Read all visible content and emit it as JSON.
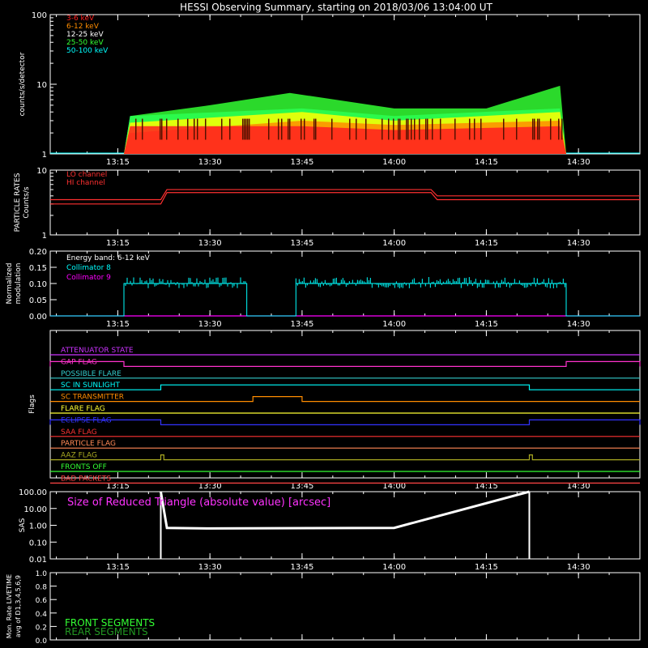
{
  "title": "HESSI Observing Summary, starting on 2018/03/06 13:04:00 UT",
  "time_labels": [
    "13:15",
    "13:30",
    "13:45",
    "14:00",
    "14:15",
    "14:30"
  ],
  "colors": {
    "bg": "#000000",
    "axis": "#ffffff",
    "band_3_6": "#ff2020",
    "band_6_12": "#ff8c00",
    "band_12_25": "#ffff00",
    "band_25_50": "#33ff33",
    "band_50_100": "#00ffff",
    "lo": "#ff3030",
    "hi": "#ff3030",
    "coll8": "#00ffff",
    "coll9": "#ff00ff",
    "sas": "#ffffff",
    "front": "#33ff33",
    "rear": "#229922"
  },
  "chart_data": [
    {
      "type": "line",
      "panel": "count-rates",
      "ylabel": "counts/s/detector",
      "ylim": [
        1,
        100
      ],
      "yscale": "log",
      "yticks": [
        "1",
        "10",
        "100"
      ],
      "legend": [
        "3-6 keV",
        "6-12 keV",
        "12-25 keV",
        "25-50 keV",
        "50-100 keV"
      ],
      "series": [
        {
          "name": "3-6 keV",
          "x": [
            "13:04",
            "13:16",
            "13:17",
            "13:45",
            "14:00",
            "14:27",
            "14:28",
            "14:40"
          ],
          "values": [
            1,
            1,
            2.5,
            2.5,
            2.2,
            2.5,
            1,
            1
          ]
        },
        {
          "name": "6-12 keV",
          "x": [
            "13:04",
            "13:16",
            "13:17",
            "13:45",
            "14:00",
            "14:27",
            "14:28",
            "14:40"
          ],
          "values": [
            1,
            1,
            2.0,
            3.0,
            2.6,
            3.0,
            1,
            1
          ]
        },
        {
          "name": "12-25 keV",
          "x": [
            "13:04",
            "13:16",
            "13:17",
            "13:45",
            "14:00",
            "14:27",
            "14:28",
            "14:40"
          ],
          "values": [
            1,
            1,
            2.8,
            4.0,
            3.0,
            4.0,
            1,
            1
          ]
        },
        {
          "name": "25-50 keV",
          "x": [
            "13:04",
            "13:16",
            "13:17",
            "13:30",
            "13:43",
            "14:00",
            "14:15",
            "14:27",
            "14:28",
            "14:40"
          ],
          "values": [
            1,
            1,
            3.5,
            5.0,
            7.5,
            4.5,
            4.5,
            9.5,
            1,
            1
          ]
        },
        {
          "name": "50-100 keV",
          "x": [
            "13:04",
            "13:16",
            "13:17",
            "13:45",
            "14:00",
            "14:27",
            "14:28",
            "14:40"
          ],
          "values": [
            1,
            1,
            3.5,
            4.5,
            3.5,
            4.5,
            1,
            1
          ]
        }
      ]
    },
    {
      "type": "line",
      "panel": "particle-rates",
      "ylabel": "PARTICLE RATES Counts/s",
      "ylim": [
        1,
        10
      ],
      "yscale": "log",
      "yticks": [
        "1",
        "10"
      ],
      "legend": [
        "LO channel",
        "HI channel"
      ],
      "series": [
        {
          "name": "LO channel",
          "x": [
            "13:04",
            "13:22",
            "13:23",
            "14:06",
            "14:07",
            "14:40"
          ],
          "values": [
            3.5,
            3.5,
            5.0,
            5.0,
            4.0,
            4.0
          ]
        },
        {
          "name": "HI channel",
          "x": [
            "13:04",
            "13:22",
            "13:23",
            "14:06",
            "14:07",
            "14:40"
          ],
          "values": [
            3.0,
            3.0,
            4.5,
            4.5,
            3.5,
            3.5
          ]
        }
      ]
    },
    {
      "type": "line",
      "panel": "modulation",
      "ylabel": "Normalized modulation",
      "ylim": [
        0,
        0.2
      ],
      "yticks": [
        "0.00",
        "0.05",
        "0.10",
        "0.15",
        "0.20"
      ],
      "legend": [
        "Energy band: 6-12 keV",
        "Collimator 8",
        "Collimator 9"
      ],
      "series": [
        {
          "name": "Collimator 8",
          "x": [
            "13:04",
            "13:16",
            "13:16",
            "13:36",
            "13:36",
            "13:44",
            "13:44",
            "14:28",
            "14:28",
            "14:40"
          ],
          "values": [
            0,
            0,
            0.1,
            0.1,
            0,
            0,
            0.1,
            0.1,
            0,
            0
          ]
        },
        {
          "name": "Collimator 9",
          "x": [
            "13:04",
            "14:40"
          ],
          "values": [
            0,
            0
          ]
        }
      ]
    },
    {
      "type": "line",
      "panel": "flags",
      "ylabel": "Flags",
      "flags": [
        {
          "name": "ATTENUATOR STATE",
          "color": "#cc33ff",
          "on": []
        },
        {
          "name": "GAP FLAG",
          "color": "#ff33cc",
          "on": [
            [
              "13:04",
              "13:16"
            ],
            [
              "14:28",
              "14:40"
            ]
          ]
        },
        {
          "name": "POSSIBLE FLARE",
          "color": "#33cccc",
          "on": []
        },
        {
          "name": "SC IN SUNLIGHT",
          "color": "#00ffff",
          "on": [
            [
              "13:22",
              "14:22"
            ]
          ]
        },
        {
          "name": "SC TRANSMITTER",
          "color": "#ff8c00",
          "on": [
            [
              "13:37",
              "13:45"
            ]
          ]
        },
        {
          "name": "FLARE FLAG",
          "color": "#ffff33",
          "on": []
        },
        {
          "name": "ECLIPSE FLAG",
          "color": "#3333ff",
          "on": [
            [
              "13:04",
              "13:22"
            ],
            [
              "14:22",
              "14:40"
            ]
          ]
        },
        {
          "name": "SAA FLAG",
          "color": "#ff3333",
          "on": []
        },
        {
          "name": "PARTICLE FLAG",
          "color": "#ff8855",
          "on": []
        },
        {
          "name": "AAZ FLAG",
          "color": "#aaaa22",
          "on": [
            [
              "13:22",
              "13:22.5"
            ],
            [
              "14:22",
              "14:22.5"
            ]
          ]
        },
        {
          "name": "FRONTS OFF",
          "color": "#33ff33",
          "on": []
        },
        {
          "name": "BAD PACKETS",
          "color": "#ff4444",
          "on": []
        }
      ]
    },
    {
      "type": "line",
      "panel": "sas",
      "ylabel": "SAS",
      "yscale": "log",
      "ylim": [
        0.01,
        100
      ],
      "yticks": [
        "0.01",
        "0.10",
        "1.00",
        "10.00",
        "100.00"
      ],
      "legend": [
        "Size of Reduced Triangle (absolute value) [arcsec]"
      ],
      "series": [
        {
          "name": "Size of Reduced Triangle (absolute value) [arcsec]",
          "x": [
            "13:22",
            "13:23",
            "13:30",
            "14:00",
            "14:22"
          ],
          "values": [
            100,
            0.7,
            0.65,
            0.7,
            100
          ]
        }
      ]
    },
    {
      "type": "line",
      "panel": "livetime",
      "ylabel": "Mon. Rate LIVETIME avg of D1,3,4,5,6,9",
      "ylim": [
        0,
        1.0
      ],
      "yticks": [
        "0.0",
        "0.2",
        "0.4",
        "0.6",
        "0.8",
        "1.0"
      ],
      "legend": [
        "FRONT SEGMENTS",
        "REAR SEGMENTS"
      ],
      "series": []
    }
  ]
}
